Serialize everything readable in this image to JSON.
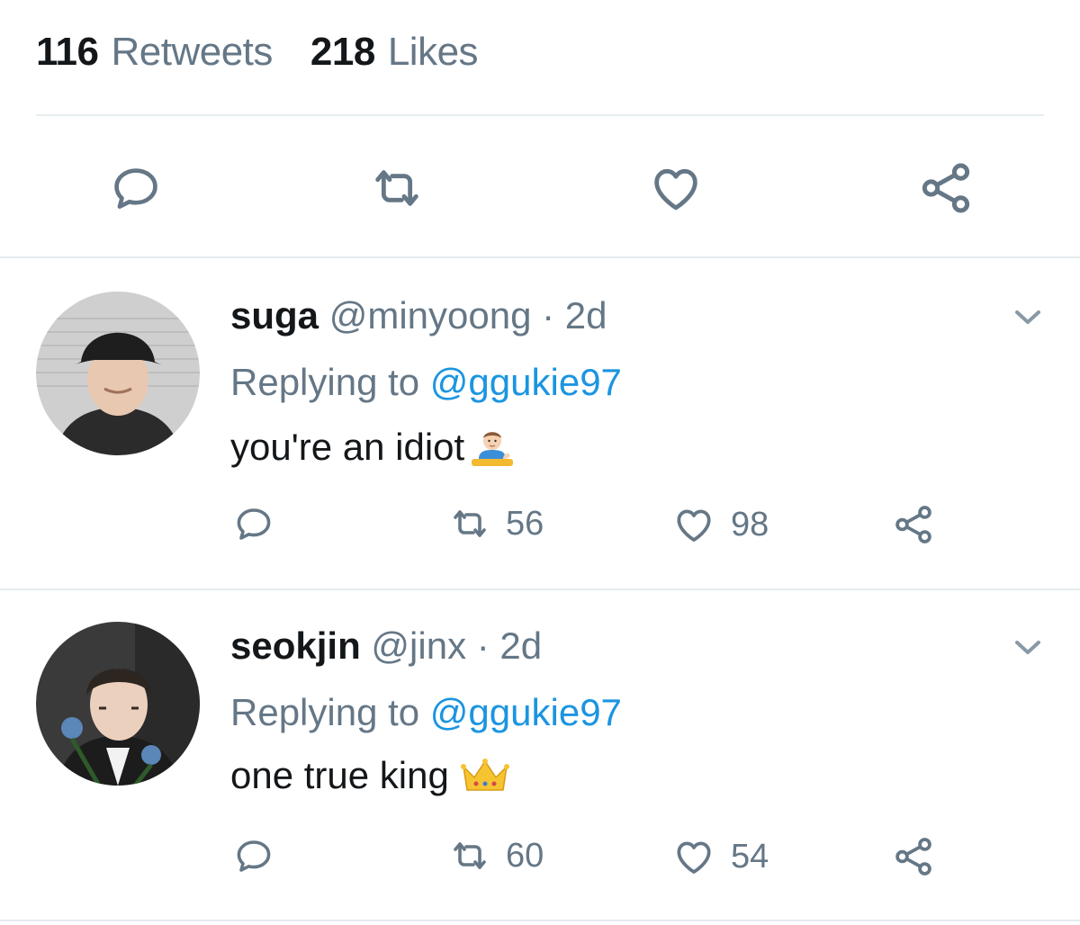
{
  "tweet_stats": {
    "retweets_count": "116",
    "retweets_label": "Retweets",
    "likes_count": "218",
    "likes_label": "Likes"
  },
  "action_bar": {
    "icons": [
      "reply-icon",
      "retweet-icon",
      "like-icon",
      "share-icon"
    ]
  },
  "colors": {
    "text_primary": "#14171a",
    "text_secondary": "#657786",
    "link": "#1b95e0",
    "divider": "#e6ecf0"
  },
  "replies": [
    {
      "name": "suga",
      "handle": "@minyoong",
      "separator": "·",
      "time": "2d",
      "replying_prefix": "Replying to",
      "replying_to": "@ggukie97",
      "text": "you're an idiot",
      "emoji": "person-tipping-hand-emoji",
      "retweets": "56",
      "likes": "98"
    },
    {
      "name": "seokjin",
      "handle": "@jinx",
      "separator": "·",
      "time": "2d",
      "replying_prefix": "Replying to",
      "replying_to": "@ggukie97",
      "text": "one true king",
      "emoji": "crown-emoji",
      "retweets": "60",
      "likes": "54"
    }
  ]
}
